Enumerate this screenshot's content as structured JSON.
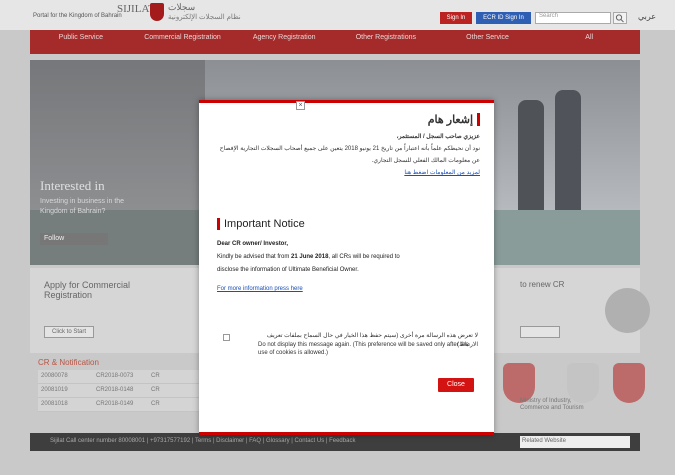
{
  "header": {
    "logo_en": "Portal for the Kingdom of Bahrain",
    "logo_name": "SIJILAT",
    "logo_ar": "سجلات",
    "logo_ar_sub": "نظام السجلات الإلكترونية",
    "signin_label": "Sign In",
    "ecr_signin_label": "ECR ID Sign In",
    "search_placeholder": "Search",
    "lang_label": "عربي"
  },
  "nav": {
    "items": [
      "Public Service",
      "Commercial Registration",
      "Agency Registration",
      "Other Registrations",
      "Other Service",
      "All"
    ]
  },
  "hero": {
    "heading": "Interested in",
    "subtext": "Investing in business in the Kingdom of Bahrain?",
    "button": "Follow"
  },
  "strip": {
    "apply_title": "Apply for Commercial Registration",
    "apply_button": "Click to Start",
    "renew_title": "to renew CR",
    "notifications_title": "CR & Notification"
  },
  "notifications": {
    "rows": [
      [
        "20080078",
        "CR2018-0073",
        "CR"
      ],
      [
        "20081019",
        "CR2018-0148",
        "CR"
      ],
      [
        "20081018",
        "CR2018-0149",
        "CR"
      ]
    ]
  },
  "partners": {
    "ministry_text": "Ministry of Industry, Commerce and Tourism"
  },
  "footer": {
    "text": "Sijilat Call center number 80008001 | +97317577192 | Terms | Disclaimer | FAQ | Glossary | Contact Us | Feedback",
    "select_value": "Related Website"
  },
  "modal": {
    "close_symbol": "×",
    "ar_title": "إشعار هام",
    "ar_greeting": "عزيزي صاحب السجل / المستثمر،",
    "ar_body": "نود أن نحيطكم علماً بأنه اعتباراً من تاريخ 21 يونيو 2018 يتعين على جميع أصحاب السجلات التجارية الإفصاح عن معلومات المالك الفعلي للسجل التجاري.",
    "ar_link": "لمزيد من المعلومات اضغط هنا",
    "en_title": "Important Notice",
    "en_greeting": "Dear CR owner/ Investor,",
    "en_body_1": "Kindly be advised that from",
    "en_date": "21 June 2018",
    "en_body_2": ", all CRs will be required to",
    "en_body_3": "disclose the information of Ultimate Beneficial Owner.",
    "en_link": "For more information press here",
    "dnd_ar": "لا تعرض هذه الرسالة مرة أخرى (سيتم حفظ هذا الخيار في حال السماح بملفات تعريف الارتباط)",
    "dnd_en": "Do not display this message again. (This preference will be saved only after the use of cookies is allowed.)",
    "close_button": "Close"
  }
}
